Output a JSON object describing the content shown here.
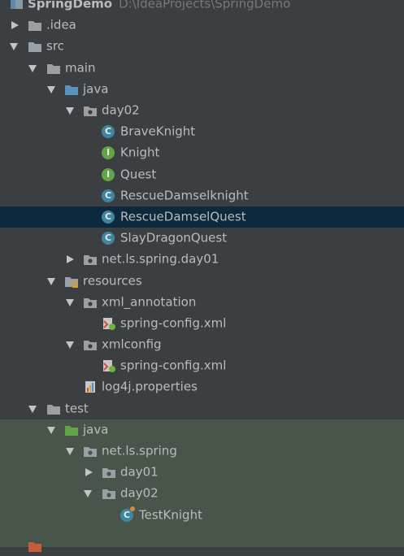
{
  "project": {
    "name": "SpringDemo",
    "path": "D:\\IdeaProjects\\SpringDemo"
  },
  "tree": [
    {
      "label": ".idea",
      "icon": "folder-icon",
      "expand": "closed"
    },
    {
      "label": "src",
      "icon": "folder-icon",
      "expand": "open"
    },
    {
      "label": "main",
      "icon": "folder-icon",
      "expand": "open"
    },
    {
      "label": "java",
      "icon": "source-folder-icon",
      "expand": "open"
    },
    {
      "label": "day02",
      "icon": "package-icon",
      "expand": "open"
    },
    {
      "label": "BraveKnight",
      "icon": "class-icon",
      "badge": "C"
    },
    {
      "label": "Knight",
      "icon": "interface-icon",
      "badge": "I"
    },
    {
      "label": "Quest",
      "icon": "interface-icon",
      "badge": "I"
    },
    {
      "label": "RescueDamselknight",
      "icon": "class-icon",
      "badge": "C"
    },
    {
      "label": "RescueDamselQuest",
      "icon": "class-icon",
      "badge": "C",
      "selected": true
    },
    {
      "label": "SlayDragonQuest",
      "icon": "class-icon",
      "badge": "C"
    },
    {
      "label": "net.ls.spring.day01",
      "icon": "package-icon",
      "expand": "closed"
    },
    {
      "label": "resources",
      "icon": "resources-folder-icon",
      "expand": "open"
    },
    {
      "label": "xml_annotation",
      "icon": "package-icon",
      "expand": "open"
    },
    {
      "label": "spring-config.xml",
      "icon": "spring-xml-icon"
    },
    {
      "label": "xmlconfig",
      "icon": "package-icon",
      "expand": "open"
    },
    {
      "label": "spring-config.xml",
      "icon": "spring-xml-icon"
    },
    {
      "label": "log4j.properties",
      "icon": "properties-file-icon"
    },
    {
      "label": "test",
      "icon": "folder-icon",
      "expand": "open"
    },
    {
      "label": "java",
      "icon": "test-source-folder-icon",
      "expand": "open"
    },
    {
      "label": "net.ls.spring",
      "icon": "package-icon",
      "expand": "open"
    },
    {
      "label": "day01",
      "icon": "package-icon",
      "expand": "closed"
    },
    {
      "label": "day02",
      "icon": "package-icon",
      "expand": "open"
    },
    {
      "label": "TestKnight",
      "icon": "test-class-icon",
      "badge": "C"
    }
  ],
  "colors": {
    "background": "#3c3f41",
    "selection": "#0d293e",
    "test_highlight": "#49544a",
    "source_folder": "#5895bd",
    "test_folder": "#62a547",
    "class": "#3e86a0",
    "interface": "#62a547"
  }
}
